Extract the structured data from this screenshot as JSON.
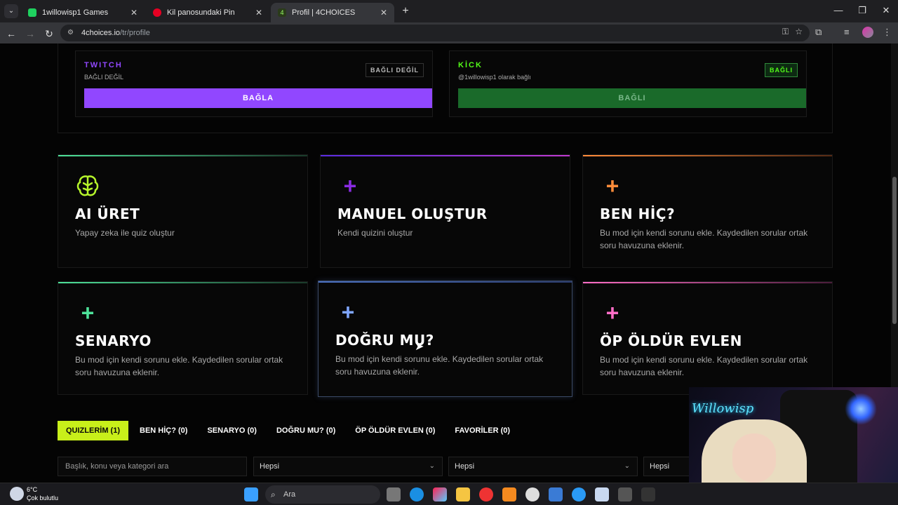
{
  "browser": {
    "tabs": [
      {
        "title": "1willowisp1 Games",
        "favicon_color": "#1fd15f",
        "active": false
      },
      {
        "title": "Kil panosundaki Pin",
        "favicon_color": "#e60023",
        "active": false
      },
      {
        "title": "Profil | 4CHOICES",
        "favicon_color": "#2a3b1a",
        "active": true
      }
    ],
    "new_tab": "+",
    "url_host": "4choices.io",
    "url_path": "/tr/profile"
  },
  "streams": {
    "twitch": {
      "name": "TWITCH",
      "status": "BAĞLI DEĞİL",
      "badge": "BAĞLI DEĞİL",
      "button": "BAĞLA",
      "color": "#9147ff"
    },
    "kick": {
      "name": "KİCK",
      "status": "@1willowisp1 olarak bağlı",
      "badge": "BAĞLI",
      "button": "BAĞLI",
      "color": "#53fc18"
    }
  },
  "cards": [
    {
      "title": "AI ÜRET",
      "desc": "Yapay zeka ile quiz oluştur",
      "icon": "brain-icon",
      "color": "#b6f52b"
    },
    {
      "title": "MANUEL OLUŞTUR",
      "desc": "Kendi quizini oluştur",
      "icon": "plus-icon",
      "color": "#8a2be2"
    },
    {
      "title": "BEN HİÇ?",
      "desc": "Bu mod için kendi sorunu ekle. Kaydedilen sorular ortak soru havuzuna eklenir.",
      "icon": "plus-icon",
      "color": "#ff8c3a"
    },
    {
      "title": "SENARYO",
      "desc": "Bu mod için kendi sorunu ekle. Kaydedilen sorular ortak soru havuzuna eklenir.",
      "icon": "plus-icon",
      "color": "#4ee29a"
    },
    {
      "title": "DOĞRU MU?",
      "desc": "Bu mod için kendi sorunu ekle. Kaydedilen sorular ortak soru havuzuna eklenir.",
      "icon": "plus-icon",
      "color": "#7fa6ff"
    },
    {
      "title": "ÖP ÖLDÜR EVLEN",
      "desc": "Bu mod için kendi sorunu ekle. Kaydedilen sorular ortak soru havuzuna eklenir.",
      "icon": "plus-icon",
      "color": "#ff6ec7"
    }
  ],
  "filter_tabs": [
    {
      "label": "QUIZLERİM (1)",
      "active": true
    },
    {
      "label": "BEN HİÇ? (0)",
      "active": false
    },
    {
      "label": "SENARYO (0)",
      "active": false
    },
    {
      "label": "DOĞRU MU? (0)",
      "active": false
    },
    {
      "label": "ÖP ÖLDÜR EVLEN (0)",
      "active": false
    },
    {
      "label": "FAVORİLER (0)",
      "active": false
    }
  ],
  "search": {
    "placeholder": "Başlık, konu veya kategori ara"
  },
  "selects": [
    "Hepsi",
    "Hepsi",
    "Hepsi"
  ],
  "taskbar": {
    "weather_temp": "6°C",
    "weather_desc": "Çok bulutlu",
    "search_label": "Ara"
  },
  "webcam": {
    "neon": "Willowisp"
  }
}
